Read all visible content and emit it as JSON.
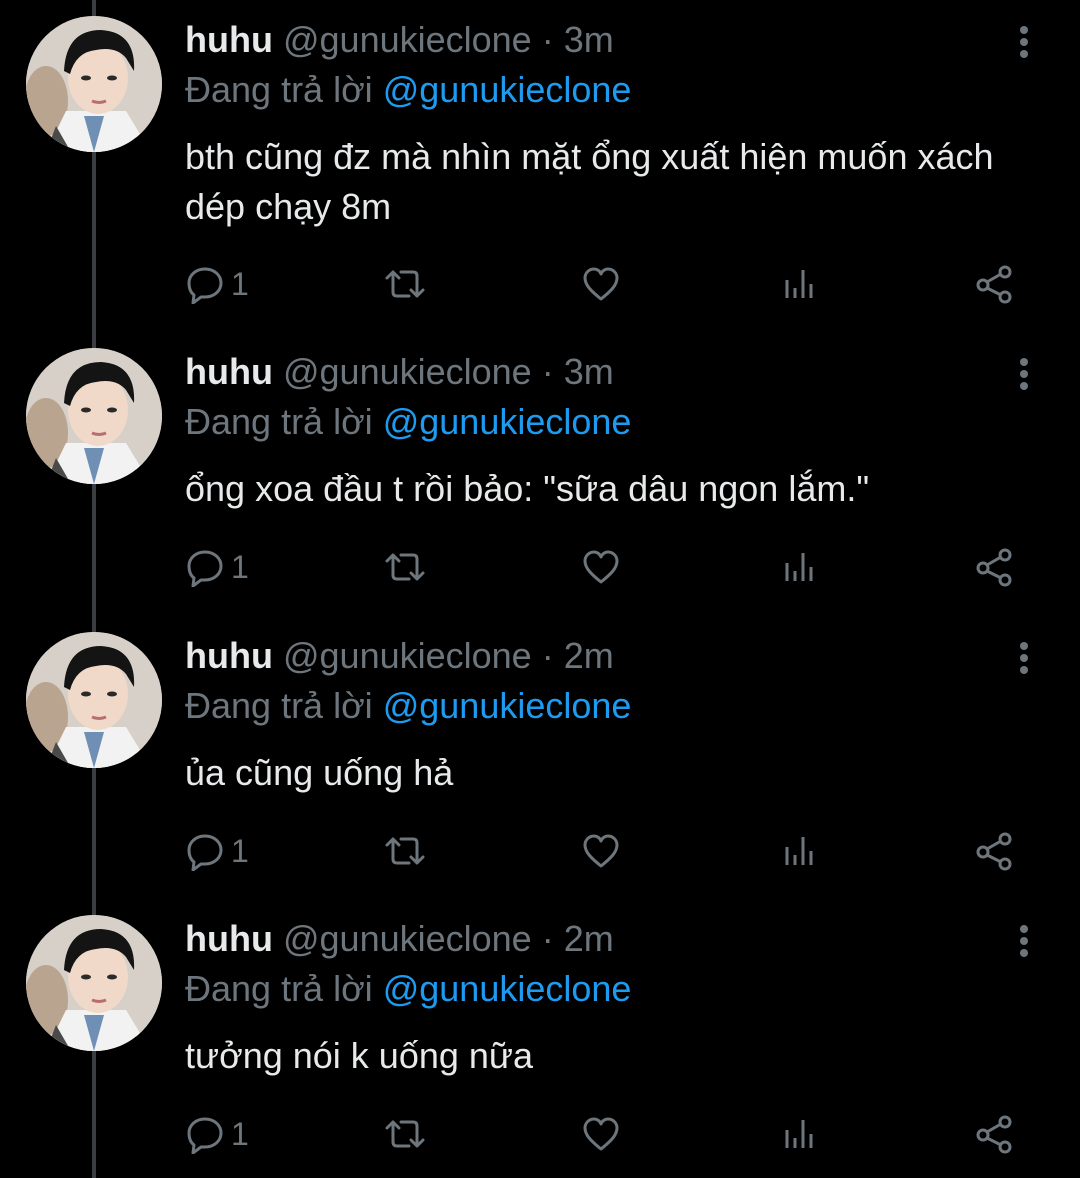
{
  "colors": {
    "background": "#000000",
    "text": "#e7e9ea",
    "muted": "#6e767d",
    "accent": "#1d9bf0",
    "thread_line": "#3a3d41"
  },
  "icons": [
    "reply-icon",
    "retweet-icon",
    "like-icon",
    "analytics-icon",
    "share-icon",
    "more-options-icon"
  ],
  "tweets": [
    {
      "name": "huhu",
      "handle": "@gunukieclone",
      "separator": "·",
      "time": "3m",
      "reply_prefix": "Đang trả lời",
      "reply_to": "@gunukieclone",
      "text": "bth cũng đz mà nhìn mặt ổng xuất hiện muốn xách dép chạy 8m",
      "reply_count": "1"
    },
    {
      "name": "huhu",
      "handle": "@gunukieclone",
      "separator": "·",
      "time": "3m",
      "reply_prefix": "Đang trả lời",
      "reply_to": "@gunukieclone",
      "text": "ổng xoa đầu t rồi bảo: \"sữa dâu ngon lắm.\"",
      "reply_count": "1"
    },
    {
      "name": "huhu",
      "handle": "@gunukieclone",
      "separator": "·",
      "time": "2m",
      "reply_prefix": "Đang trả lời",
      "reply_to": "@gunukieclone",
      "text": "ủa cũng uống hả",
      "reply_count": "1"
    },
    {
      "name": "huhu",
      "handle": "@gunukieclone",
      "separator": "·",
      "time": "2m",
      "reply_prefix": "Đang trả lời",
      "reply_to": "@gunukieclone",
      "text": "tưởng nói k uống nữa",
      "reply_count": "1"
    }
  ]
}
